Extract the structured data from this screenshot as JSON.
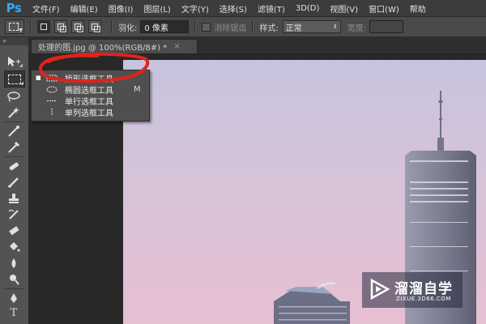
{
  "app": {
    "logo": "Ps",
    "accent": "#31a8ff"
  },
  "menu": [
    {
      "label": "文件(F)"
    },
    {
      "label": "编辑(E)"
    },
    {
      "label": "图像(I)"
    },
    {
      "label": "图层(L)"
    },
    {
      "label": "文字(Y)"
    },
    {
      "label": "选择(S)"
    },
    {
      "label": "滤镜(T)"
    },
    {
      "label": "3D(D)"
    },
    {
      "label": "视图(V)"
    },
    {
      "label": "窗口(W)"
    },
    {
      "label": "帮助"
    }
  ],
  "options": {
    "feather_label": "羽化:",
    "feather_value": "0 像素",
    "antialias_label": "消除锯齿",
    "style_label": "样式:",
    "style_value": "正常",
    "width_label": "宽度:"
  },
  "document_tab": {
    "title": "处理的图.jpg @ 100%(RGB/8#) *",
    "close": "×"
  },
  "flyout": {
    "items": [
      {
        "label": "矩形选框工具",
        "shortcut": "",
        "icon": "rect-marquee-icon",
        "selected": true
      },
      {
        "label": "椭圆选框工具",
        "shortcut": "M",
        "icon": "ellipse-marquee-icon",
        "selected": false
      },
      {
        "label": "单行选框工具",
        "shortcut": "",
        "icon": "single-row-marquee-icon",
        "selected": false
      },
      {
        "label": "单列选框工具",
        "shortcut": "",
        "icon": "single-column-marquee-icon",
        "selected": false
      }
    ]
  },
  "annotation": {
    "color": "#e0231b"
  },
  "watermark": {
    "title": "溜溜自学",
    "url": "ZIXUE.3D66.COM"
  }
}
